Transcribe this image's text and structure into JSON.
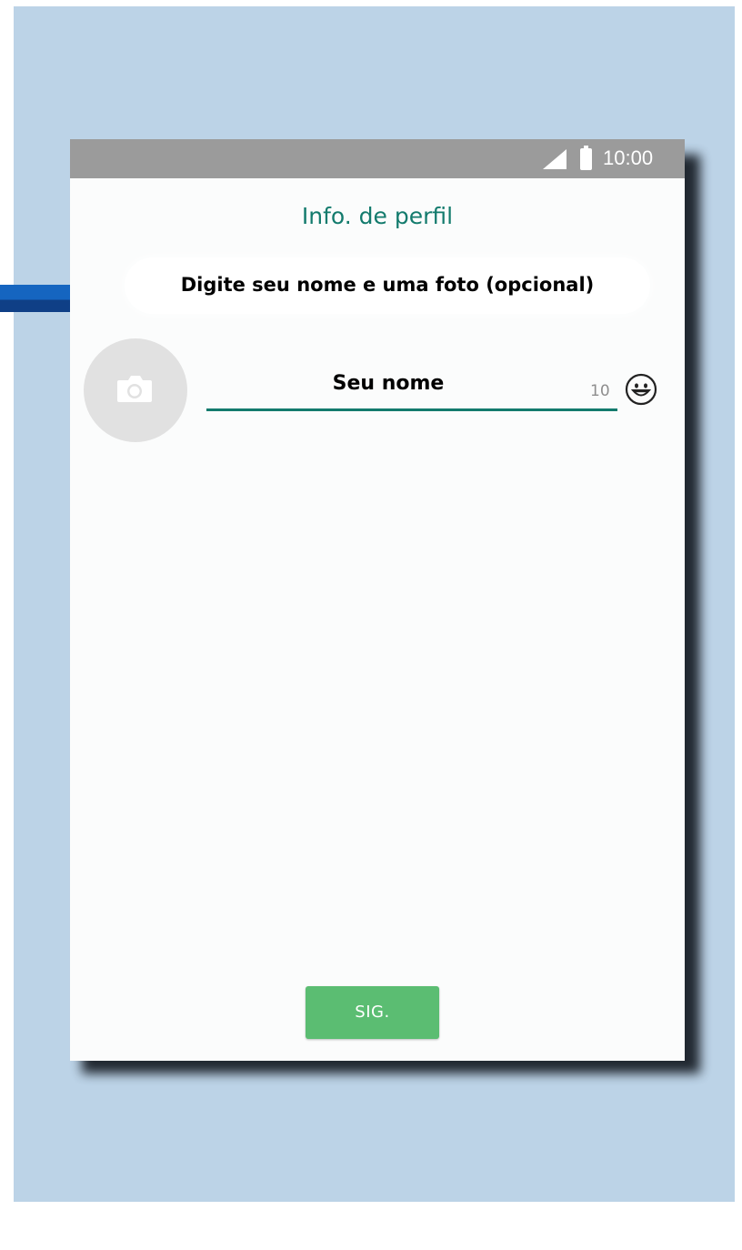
{
  "status_bar": {
    "time": "10:00"
  },
  "profile": {
    "title": "Info. de perfil",
    "subtitle": "Digite seu nome e uma foto (opcional)",
    "name_placeholder": "Seu nome",
    "name_value": "",
    "char_remaining": "10"
  },
  "actions": {
    "next_label": "SIG."
  },
  "colors": {
    "accent": "#137b6d",
    "button": "#5bbd72",
    "status_bar": "#9b9b9b",
    "background_panel": "#bcd3e7",
    "side_accent": "#1565c0"
  },
  "icons": {
    "signal": "signal-icon",
    "battery": "battery-icon",
    "camera": "camera-icon",
    "emoji": "emoji-icon"
  }
}
